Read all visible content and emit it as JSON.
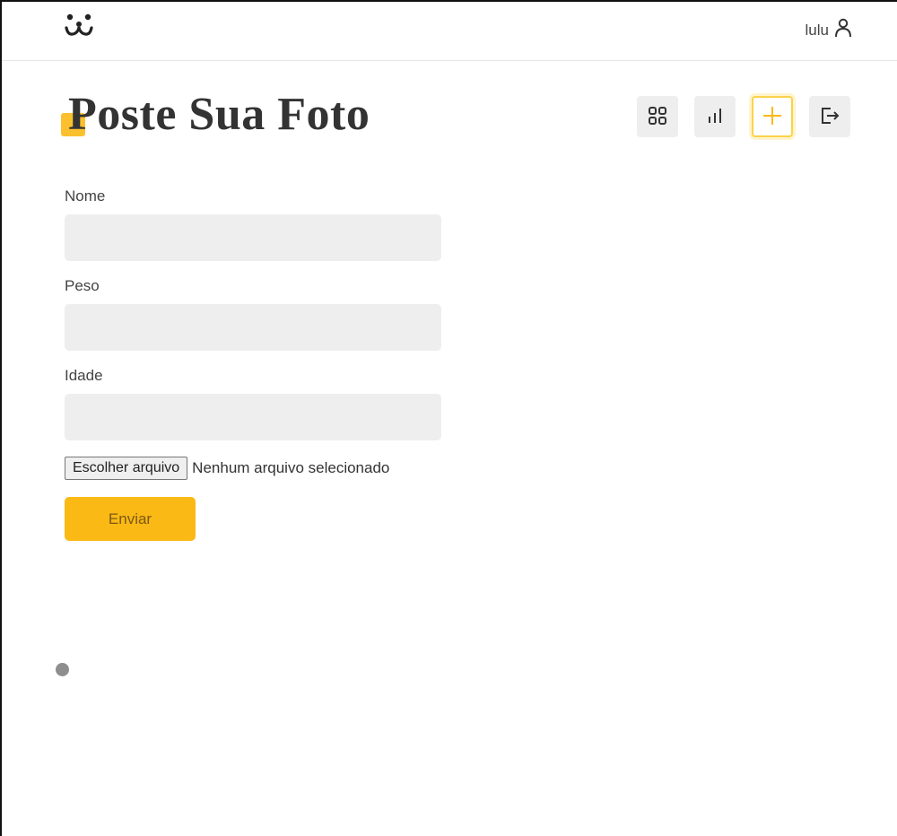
{
  "header": {
    "logo_icon": "dog-face-logo-icon",
    "user": {
      "name": "lulu",
      "icon": "user-icon"
    }
  },
  "page": {
    "title": "Poste Sua Foto",
    "accent_color": "#fbb916"
  },
  "nav": [
    {
      "icon": "grid-icon",
      "active": false
    },
    {
      "icon": "bar-chart-icon",
      "active": false
    },
    {
      "icon": "plus-icon",
      "active": true
    },
    {
      "icon": "logout-icon",
      "active": false
    }
  ],
  "form": {
    "fields": [
      {
        "label": "Nome",
        "value": ""
      },
      {
        "label": "Peso",
        "value": ""
      },
      {
        "label": "Idade",
        "value": ""
      }
    ],
    "file": {
      "button_label": "Escolher arquivo",
      "status": "Nenhum arquivo selecionado"
    },
    "submit_label": "Enviar"
  }
}
